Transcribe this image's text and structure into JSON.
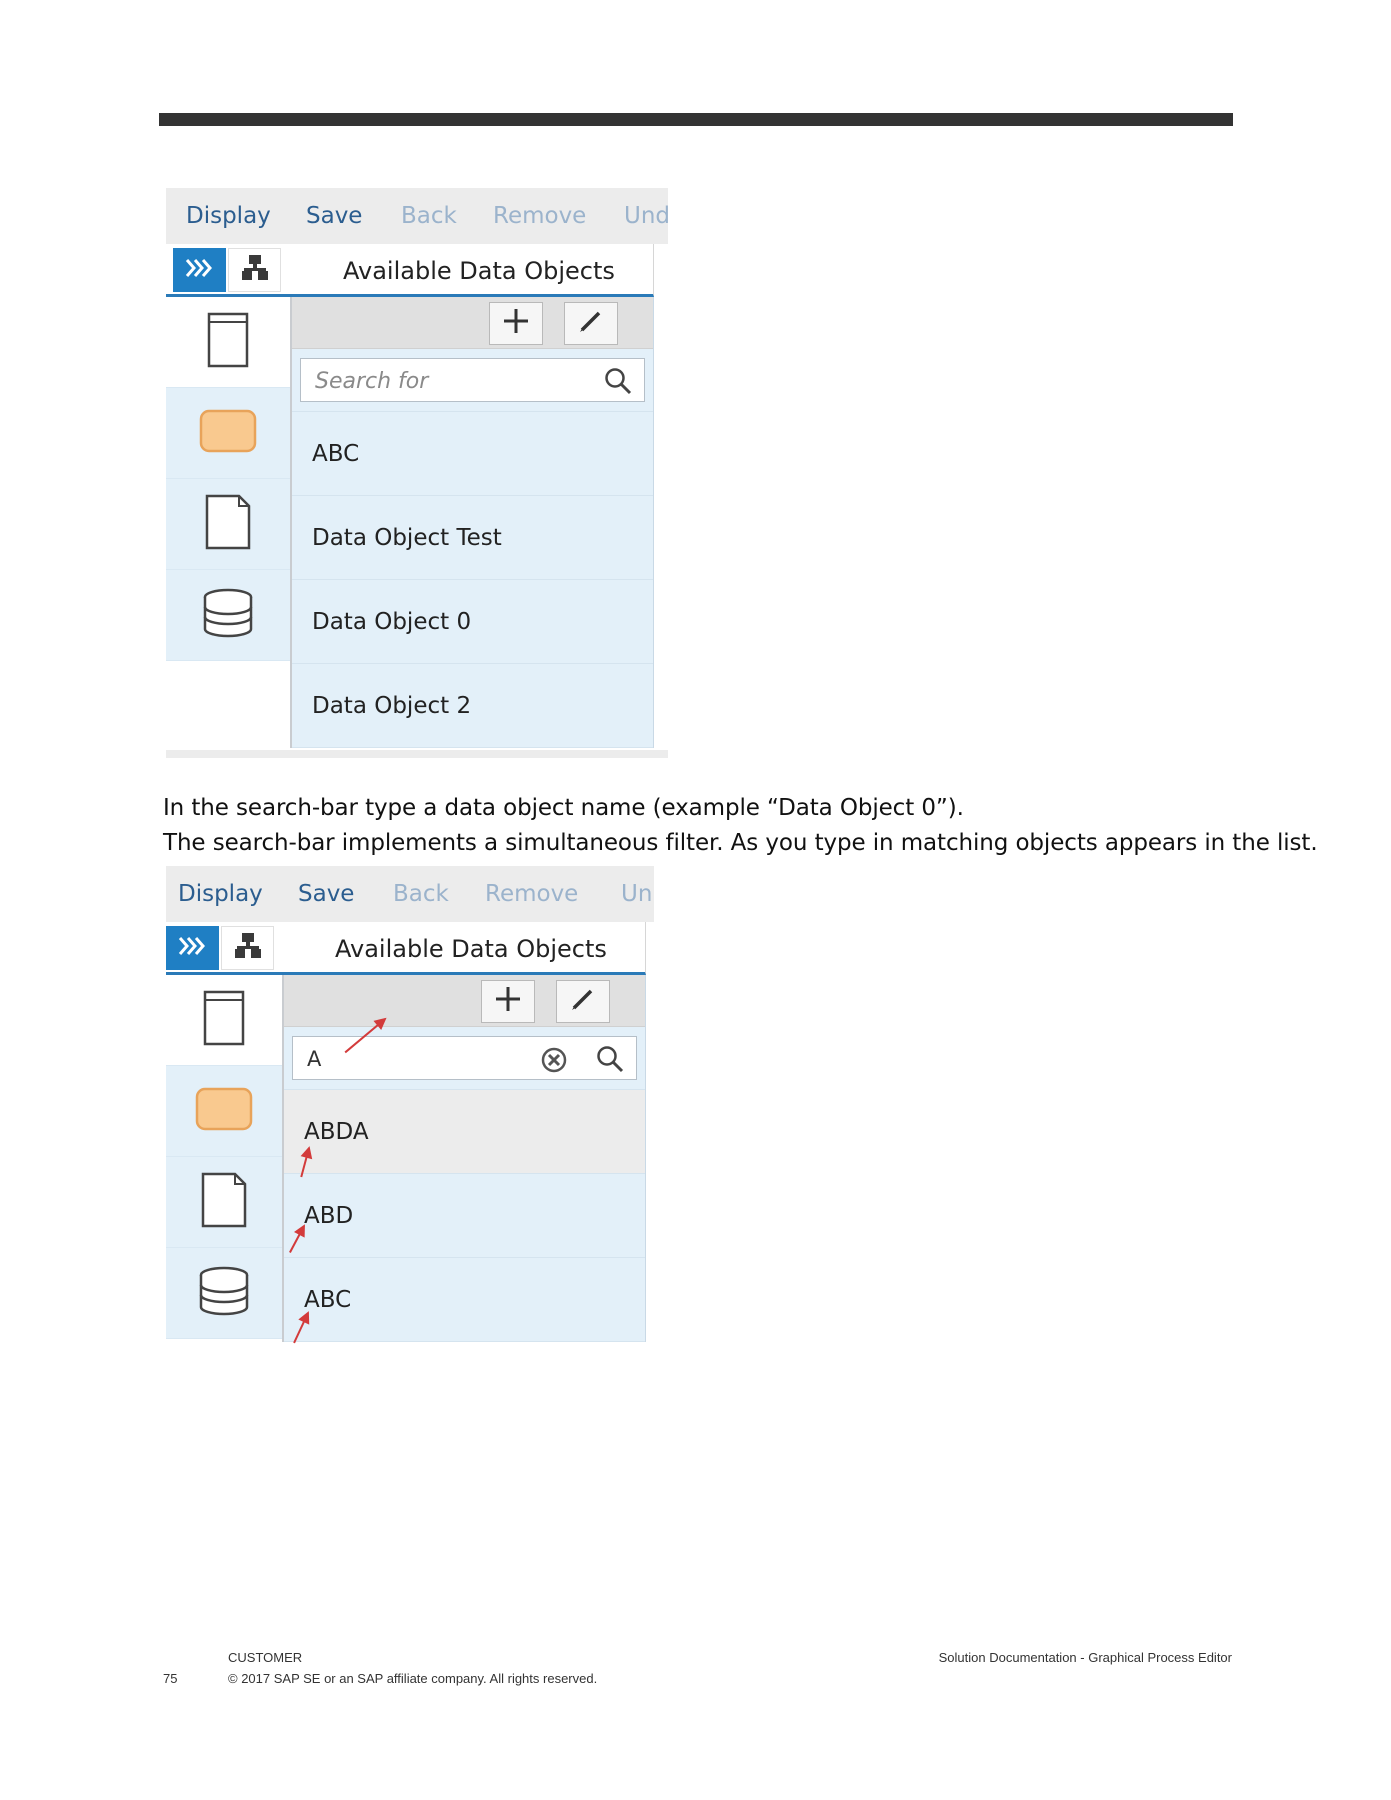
{
  "screenshot_1": {
    "menu": {
      "display": "Display",
      "save": "Save",
      "back": "Back",
      "remove": "Remove",
      "undo": "Und"
    },
    "title": "Available Data Objects",
    "search_placeholder": "Search for",
    "items": [
      "ABC",
      "Data Object Test",
      "Data Object 0",
      "Data Object 2"
    ]
  },
  "instructions": {
    "line1": "In the search-bar type a data object name (example “Data Object 0”).",
    "line2": "The search-bar implements a simultaneous filter. As you type in matching objects appears in the list."
  },
  "screenshot_2": {
    "menu": {
      "display": "Display",
      "save": "Save",
      "back": "Back",
      "remove": "Remove",
      "undo": "Un"
    },
    "title": "Available Data Objects",
    "search_value": "A",
    "items": [
      "ABDA",
      "ABD",
      "ABC"
    ]
  },
  "footer": {
    "page_number": "75",
    "classification": "CUSTOMER",
    "copyright": "© 2017 SAP SE or an SAP affiliate company. All rights reserved.",
    "doc_title": "Solution Documentation - Graphical Process Editor"
  },
  "colors": {
    "accent": "#1f7fc4",
    "list_bg": "#e3f0f9",
    "annotation_arrow": "#d33b3b"
  }
}
